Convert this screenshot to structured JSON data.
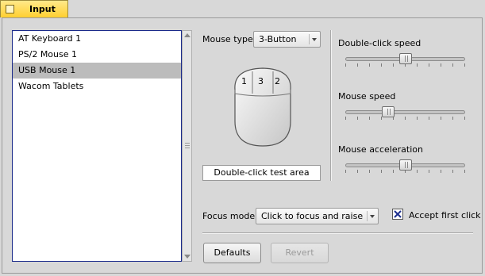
{
  "tab": {
    "title": "Input"
  },
  "devices": {
    "items": [
      {
        "label": "AT Keyboard 1",
        "selected": false
      },
      {
        "label": "PS/2 Mouse 1",
        "selected": false
      },
      {
        "label": "USB Mouse 1",
        "selected": true
      },
      {
        "label": "Wacom Tablets",
        "selected": false
      }
    ]
  },
  "mouse": {
    "type_label": "Mouse type:",
    "type_value": "3-Button",
    "buttons": [
      "1",
      "3",
      "2"
    ],
    "test_area": "Double-click test area"
  },
  "sliders": {
    "double_click": {
      "label": "Double-click speed",
      "value": 0.5
    },
    "speed": {
      "label": "Mouse speed",
      "value": 0.34
    },
    "acceleration": {
      "label": "Mouse acceleration",
      "value": 0.5
    }
  },
  "focus": {
    "label": "Focus mode:",
    "value": "Click to focus and raise",
    "accept_first_click": {
      "label": "Accept first click",
      "checked": true
    }
  },
  "buttons": {
    "defaults": "Defaults",
    "revert": "Revert"
  }
}
